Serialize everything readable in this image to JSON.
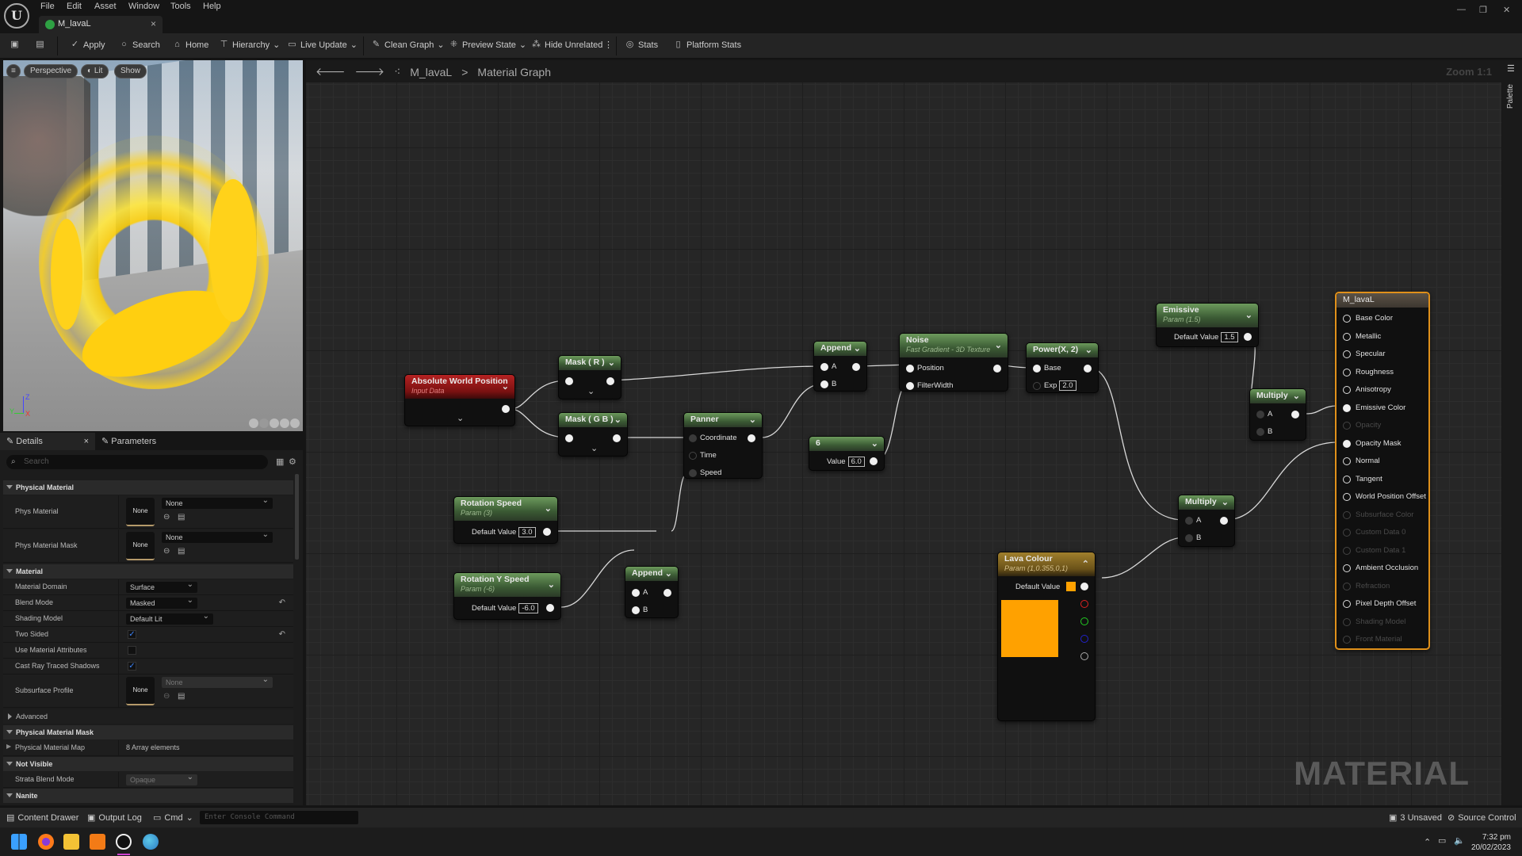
{
  "menu": [
    "File",
    "Edit",
    "Asset",
    "Window",
    "Tools",
    "Help"
  ],
  "doc_tab": {
    "label": "M_lavaL",
    "close": "×"
  },
  "window_controls": {
    "minimize": "—",
    "restore": "❐",
    "close": "✕"
  },
  "toolbar": {
    "save": "save-icon",
    "browse": "browse-icon",
    "items": [
      "Apply",
      "Search",
      "Home",
      "Hierarchy",
      "Live Update",
      "Clean Graph",
      "Preview State",
      "Hide Unrelated",
      "Stats",
      "Platform Stats"
    ]
  },
  "viewport": {
    "menu": "≡",
    "perspective": "Perspective",
    "lit": "Lit",
    "show": "Show",
    "axis_z": "Z",
    "axis_y": "Y",
    "axis_x": "X"
  },
  "details": {
    "tab_details": "Details",
    "tab_close": "×",
    "tab_parameters": "Parameters",
    "search_placeholder": "Search",
    "sections": {
      "physical_material": "Physical Material",
      "material": "Material",
      "advanced": "Advanced",
      "physical_material_mask": "Physical Material Mask",
      "not_visible": "Not Visible",
      "nanite": "Nanite"
    },
    "phys_material": {
      "label": "Phys Material",
      "thumb": "None",
      "value": "None"
    },
    "phys_material_mask": {
      "label": "Phys Material Mask",
      "thumb": "None",
      "value": "None"
    },
    "material_domain": {
      "label": "Material Domain",
      "value": "Surface"
    },
    "blend_mode": {
      "label": "Blend Mode",
      "value": "Masked"
    },
    "shading_model": {
      "label": "Shading Model",
      "value": "Default Lit"
    },
    "two_sided": {
      "label": "Two Sided",
      "checked": true
    },
    "use_material_attributes": {
      "label": "Use Material Attributes",
      "checked": false
    },
    "cast_ray_traced_shadows": {
      "label": "Cast Ray Traced Shadows",
      "checked": true
    },
    "subsurface_profile": {
      "label": "Subsurface Profile",
      "thumb": "None",
      "value": "None"
    },
    "physical_material_map": {
      "label": "Physical Material Map",
      "value": "8 Array elements"
    },
    "strata_blend_mode": {
      "label": "Strata Blend Mode",
      "value": "Opaque"
    }
  },
  "statusbar": {
    "content_drawer": "Content Drawer",
    "output_log": "Output Log",
    "cmd": "Cmd",
    "console_placeholder": "Enter Console Command",
    "unsaved": "3 Unsaved",
    "source_control": "Source Control"
  },
  "taskbar": {
    "time": "7:32 pm",
    "date": "20/02/2023"
  },
  "graph": {
    "breadcrumb_asset": "M_lavaL",
    "breadcrumb_sep": ">",
    "breadcrumb_graph": "Material Graph",
    "zoom": "Zoom 1:1",
    "watermark": "MATERIAL",
    "palette": "Palette",
    "nodes": {
      "abs_world_pos": {
        "title": "Absolute World Position",
        "sub": "Input Data"
      },
      "mask_r": {
        "title": "Mask ( R )"
      },
      "mask_gb": {
        "title": "Mask ( G B )"
      },
      "append1": {
        "title": "Append",
        "pins": [
          "A",
          "B"
        ]
      },
      "panner": {
        "title": "Panner",
        "pins": [
          "Coordinate",
          "Time",
          "Speed"
        ]
      },
      "noise": {
        "title": "Noise",
        "sub": "Fast Gradient - 3D Texture",
        "pins": [
          "Position",
          "FilterWidth"
        ]
      },
      "power": {
        "title": "Power(X, 2)",
        "pins": [
          "Base",
          "Exp"
        ],
        "exp": "2.0"
      },
      "const6": {
        "title": "6",
        "label": "Value",
        "value": "6.0"
      },
      "rotation_speed": {
        "title": "Rotation  Speed",
        "sub": "Param (3)",
        "label": "Default Value",
        "value": "3.0"
      },
      "rotation_y_speed": {
        "title": "Rotation Y Speed",
        "sub": "Param (-6)",
        "label": "Default Value",
        "value": "-6.0"
      },
      "append2": {
        "title": "Append",
        "pins": [
          "A",
          "B"
        ]
      },
      "emissive": {
        "title": "Emissive",
        "sub": "Param (1.5)",
        "label": "Default Value",
        "value": "1.5"
      },
      "multiply1": {
        "title": "Multiply",
        "pins": [
          "A",
          "B"
        ]
      },
      "multiply2": {
        "title": "Multiply",
        "pins": [
          "A",
          "B"
        ]
      },
      "lava_colour": {
        "title": "Lava Colour",
        "sub": "Param (1,0.355,0,1)",
        "label": "Default Value",
        "color": "#ffa100"
      },
      "material": {
        "title": "M_lavaL",
        "pins": [
          {
            "label": "Base Color",
            "state": "empty"
          },
          {
            "label": "Metallic",
            "state": "empty"
          },
          {
            "label": "Specular",
            "state": "empty"
          },
          {
            "label": "Roughness",
            "state": "empty"
          },
          {
            "label": "Anisotropy",
            "state": "empty"
          },
          {
            "label": "Emissive Color",
            "state": "connected"
          },
          {
            "label": "Opacity",
            "state": "disabled"
          },
          {
            "label": "Opacity Mask",
            "state": "connected"
          },
          {
            "label": "Normal",
            "state": "empty"
          },
          {
            "label": "Tangent",
            "state": "empty"
          },
          {
            "label": "World Position Offset",
            "state": "empty"
          },
          {
            "label": "Subsurface Color",
            "state": "disabled"
          },
          {
            "label": "Custom Data 0",
            "state": "disabled"
          },
          {
            "label": "Custom Data 1",
            "state": "disabled"
          },
          {
            "label": "Ambient Occlusion",
            "state": "empty"
          },
          {
            "label": "Refraction",
            "state": "disabled"
          },
          {
            "label": "Pixel Depth Offset",
            "state": "empty"
          },
          {
            "label": "Shading Model",
            "state": "disabled"
          },
          {
            "label": "Front Material",
            "state": "disabled"
          }
        ]
      }
    }
  },
  "colors": {
    "accent_orange": "#e0901a",
    "lava": "#ffa100",
    "node_green": "#5b8a4c",
    "node_red": "#b52222"
  }
}
